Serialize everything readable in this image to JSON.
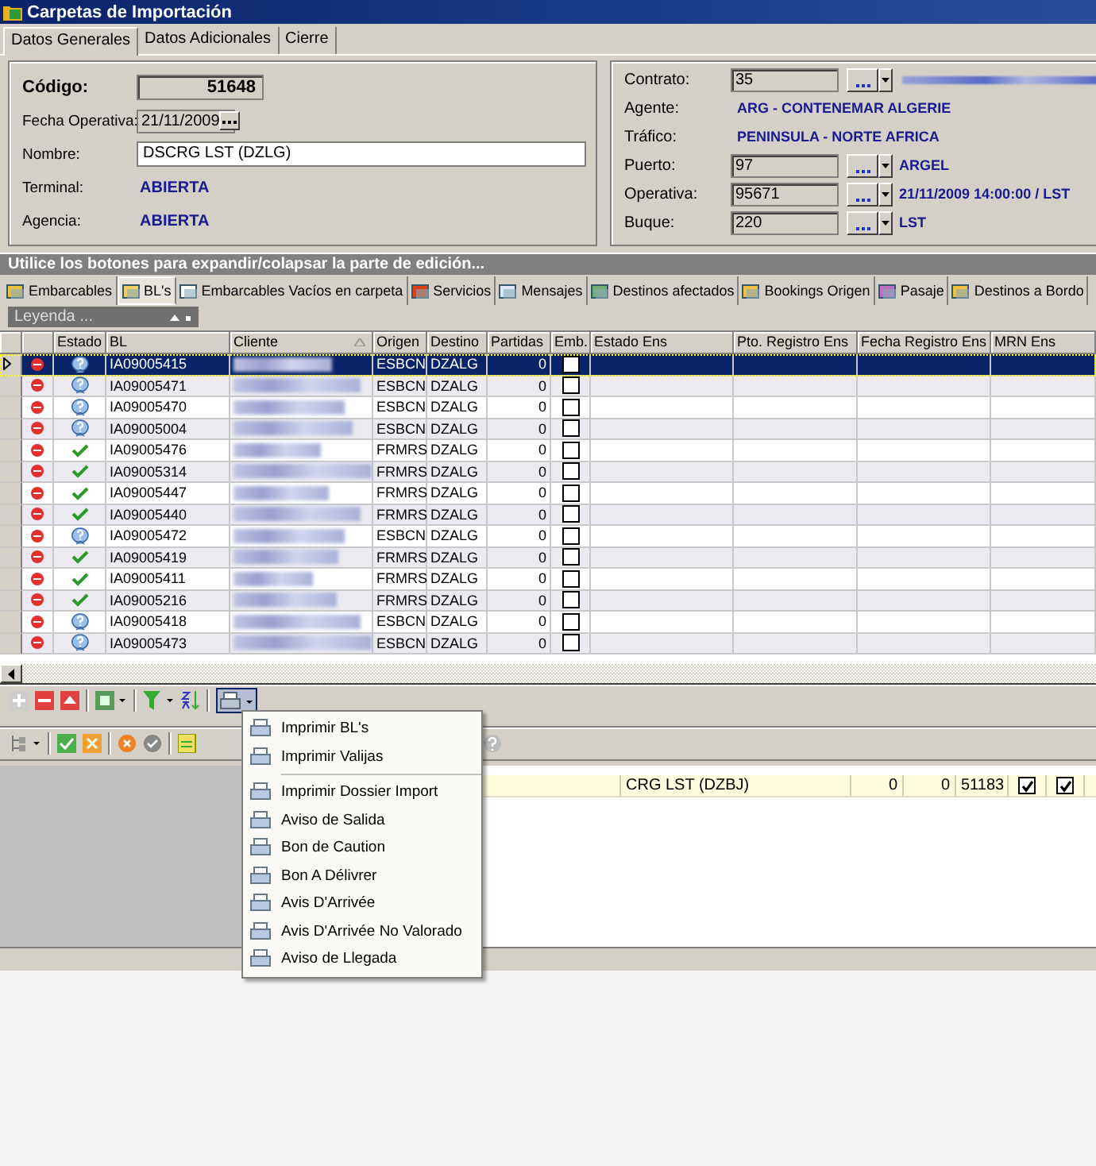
{
  "window": {
    "title": "Carpetas de Importación"
  },
  "tabs": [
    {
      "label": "Datos Generales",
      "selected": true
    },
    {
      "label": "Datos Adicionales",
      "selected": false
    },
    {
      "label": "Cierre",
      "selected": false
    }
  ],
  "general": {
    "codigo": {
      "label": "Código:",
      "value": "51648"
    },
    "fecha": {
      "label": "Fecha Operativa:",
      "value": "21/11/2009"
    },
    "nombre": {
      "label": "Nombre:",
      "value": "DSCRG LST (DZLG)"
    },
    "terminal": {
      "label": "Terminal:",
      "value": "ABIERTA"
    },
    "agencia": {
      "label": "Agencia:",
      "value": "ABIERTA"
    },
    "right": [
      {
        "kind": "lookup",
        "label": "Contrato:",
        "value": "35",
        "redacted": true
      },
      {
        "kind": "text",
        "label": "Agente:",
        "text": "ARG - CONTENEMAR ALGERIE"
      },
      {
        "kind": "text",
        "label": "Tráfico:",
        "text": "PENINSULA - NORTE AFRICA"
      },
      {
        "kind": "lookup",
        "label": "Puerto:",
        "value": "97",
        "text": "ARGEL"
      },
      {
        "kind": "lookup",
        "label": "Operativa:",
        "value": "95671",
        "text": "21/11/2009 14:00:00 / LST"
      },
      {
        "kind": "lookup",
        "label": "Buque:",
        "value": "220",
        "text": "LST"
      }
    ]
  },
  "hint": "Utilice los botones para expandir/colapsar la parte de edición...",
  "detail_tabs": [
    {
      "label": "Embarcables",
      "selected": false
    },
    {
      "label": "BL's",
      "selected": true
    },
    {
      "label": "Embarcables Vacíos en carpeta",
      "selected": false
    },
    {
      "label": "Servicios",
      "selected": false
    },
    {
      "label": "Mensajes",
      "selected": false
    },
    {
      "label": "Destinos afectados",
      "selected": false
    },
    {
      "label": "Bookings Origen",
      "selected": false
    },
    {
      "label": "Pasaje",
      "selected": false
    },
    {
      "label": "Destinos a Bordo",
      "selected": false
    }
  ],
  "legend": {
    "label": "Leyenda ..."
  },
  "grid": {
    "columns": [
      "Estado",
      "BL",
      "Cliente",
      "Origen",
      "Destino",
      "Partidas",
      "Emb.",
      "Estado Ens",
      "Pto. Registro Ens",
      "Fecha Registro Ens",
      "MRN Ens"
    ],
    "rows": [
      {
        "confirmed": false,
        "bl": "IA09005415",
        "origen": "ESBCN",
        "destino": "DZALG",
        "partidas": "0",
        "emb": false,
        "selected": true
      },
      {
        "confirmed": false,
        "bl": "IA09005471",
        "origen": "ESBCN",
        "destino": "DZALG",
        "partidas": "0",
        "emb": false,
        "selected": false
      },
      {
        "confirmed": false,
        "bl": "IA09005470",
        "origen": "ESBCN",
        "destino": "DZALG",
        "partidas": "0",
        "emb": false,
        "selected": false
      },
      {
        "confirmed": false,
        "bl": "IA09005004",
        "origen": "ESBCN",
        "destino": "DZALG",
        "partidas": "0",
        "emb": false,
        "selected": false
      },
      {
        "confirmed": true,
        "bl": "IA09005476",
        "origen": "FRMRS",
        "destino": "DZALG",
        "partidas": "0",
        "emb": false,
        "selected": false
      },
      {
        "confirmed": true,
        "bl": "IA09005314",
        "origen": "FRMRS",
        "destino": "DZALG",
        "partidas": "0",
        "emb": false,
        "selected": false
      },
      {
        "confirmed": true,
        "bl": "IA09005447",
        "origen": "FRMRS",
        "destino": "DZALG",
        "partidas": "0",
        "emb": false,
        "selected": false
      },
      {
        "confirmed": true,
        "bl": "IA09005440",
        "origen": "FRMRS",
        "destino": "DZALG",
        "partidas": "0",
        "emb": false,
        "selected": false
      },
      {
        "confirmed": false,
        "bl": "IA09005472",
        "origen": "ESBCN",
        "destino": "DZALG",
        "partidas": "0",
        "emb": false,
        "selected": false
      },
      {
        "confirmed": true,
        "bl": "IA09005419",
        "origen": "FRMRS",
        "destino": "DZALG",
        "partidas": "0",
        "emb": false,
        "selected": false
      },
      {
        "confirmed": true,
        "bl": "IA09005411",
        "origen": "FRMRS",
        "destino": "DZALG",
        "partidas": "0",
        "emb": false,
        "selected": false
      },
      {
        "confirmed": true,
        "bl": "IA09005216",
        "origen": "FRMRS",
        "destino": "DZALG",
        "partidas": "0",
        "emb": false,
        "selected": false
      },
      {
        "confirmed": false,
        "bl": "IA09005418",
        "origen": "ESBCN",
        "destino": "DZALG",
        "partidas": "0",
        "emb": false,
        "selected": false
      },
      {
        "confirmed": false,
        "bl": "IA09005473",
        "origen": "ESBCN",
        "destino": "DZALG",
        "partidas": "0",
        "emb": false,
        "selected": false
      }
    ]
  },
  "lower_grid": {
    "rows": [
      {
        "cells": [
          "CRG LST (DZBJ)",
          "0",
          "0",
          "51183"
        ],
        "checks": [
          true,
          true
        ]
      }
    ]
  },
  "print_menu": {
    "sections": [
      {
        "items": [
          "Imprimir BL's",
          "Imprimir Valijas"
        ]
      },
      {
        "items": [
          "Imprimir Dossier Import",
          "Aviso de Salida",
          "Bon de Caution",
          "Bon A Délivrer",
          "Avis D'Arrivée",
          "Avis D'Arrivée No Valorado",
          "Aviso de Llegada"
        ]
      }
    ]
  }
}
